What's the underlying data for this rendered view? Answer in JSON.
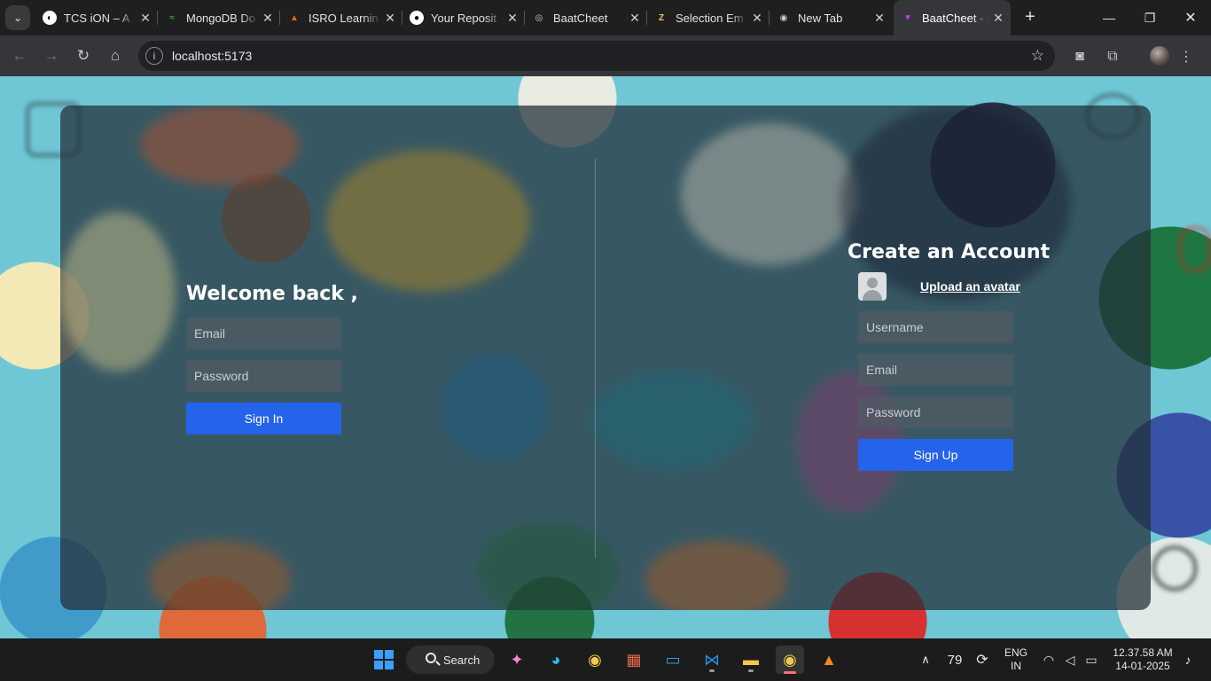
{
  "browser": {
    "tabs": [
      {
        "label": "TCS iON – A",
        "favicon": "tcs-icon",
        "color": "#ffffff"
      },
      {
        "label": "MongoDB Do",
        "favicon": "mongodb-icon",
        "color": "#3fa037"
      },
      {
        "label": "ISRO Learnin",
        "favicon": "isro-icon",
        "color": "#e06c1a"
      },
      {
        "label": "Your Reposit",
        "favicon": "github-icon",
        "color": "#ffffff"
      },
      {
        "label": "BaatCheet",
        "favicon": "globe-icon",
        "color": "#cfcfcf"
      },
      {
        "label": "Selection Em",
        "favicon": "selection-icon",
        "color": "#f2c94c"
      },
      {
        "label": "New Tab",
        "favicon": "chrome-icon",
        "color": "#cfcfcf"
      },
      {
        "label": "BaatCheet - (",
        "favicon": "vite-icon",
        "color": "#bd34fe",
        "active": true
      }
    ],
    "url": "localhost:5173"
  },
  "login": {
    "title": "Welcome back ,",
    "email_placeholder": "Email",
    "password_placeholder": "Password",
    "button": "Sign In"
  },
  "signup": {
    "title": "Create an Account",
    "upload_label": "Upload an avatar",
    "username_placeholder": "Username",
    "email_placeholder": "Email",
    "password_placeholder": "Password",
    "button": "Sign Up"
  },
  "taskbar": {
    "search_label": "Search",
    "weather_value": "79",
    "language_line1": "ENG",
    "language_line2": "IN",
    "time": "12.37.58 AM",
    "date": "14-01-2025"
  },
  "colors": {
    "accent": "#2563eb",
    "page_background": "#6fc7d6"
  }
}
